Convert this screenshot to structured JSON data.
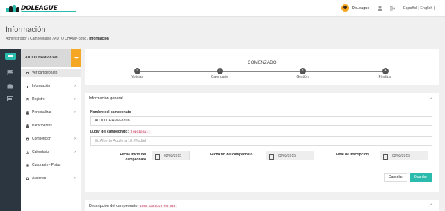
{
  "app": {
    "logo_text": "DOLEAGUE",
    "brand_color": "#2bbbad"
  },
  "header": {
    "user_name": "DoLeague",
    "lang": "Español | English |"
  },
  "page": {
    "title": "Información",
    "breadcrumb": {
      "path": "Administrador / Campeonatos / AUTO CHAMP-8398 / ",
      "current": "Información"
    }
  },
  "sidebar": {
    "championship": "AUTO CHAMP-8398",
    "items": [
      {
        "label": "Ver campeonato",
        "icon": "eye-icon"
      },
      {
        "label": "Información",
        "icon": "info-icon"
      },
      {
        "label": "Registro",
        "icon": "sitemap-icon"
      },
      {
        "label": "Personalizar",
        "icon": "paint-icon"
      },
      {
        "label": "Participantes",
        "icon": "user-icon"
      },
      {
        "label": "Competición",
        "icon": "gear-icon"
      },
      {
        "label": "Calendario",
        "icon": "clock-icon"
      },
      {
        "label": "Cuadrante - Pistas",
        "icon": "grid-icon"
      },
      {
        "label": "Acciones",
        "icon": "gear-icon"
      }
    ]
  },
  "steps": {
    "status": "COMENZADO",
    "items": [
      {
        "num": "1",
        "label": "Noticias"
      },
      {
        "num": "2",
        "label": "Calendario"
      },
      {
        "num": "3",
        "label": "Gestión"
      },
      {
        "num": "4",
        "label": "Finalizar"
      }
    ]
  },
  "general_info": {
    "heading": "Información general",
    "name_label": "Nombre del campeonato",
    "name_value": "AUTO CHAMP-8398",
    "place_label": "Lugar del campeonato:",
    "optional": "(opcional)",
    "place_placeholder": "Ej. Alberto Aguilera 10, Madrid",
    "start_label": "Fecha inicio del campeonato",
    "start_value": "02/03/2015",
    "end_label": "Fecha fin del campeonato",
    "end_value": "02/03/2015",
    "reg_end_label": "Final de inscripción",
    "reg_end_value": "02/03/2015",
    "cancel": "Cancelar",
    "save": "Guardar"
  },
  "description": {
    "heading": "Descripción del campeonato",
    "limit": "2500 caracteres max"
  }
}
